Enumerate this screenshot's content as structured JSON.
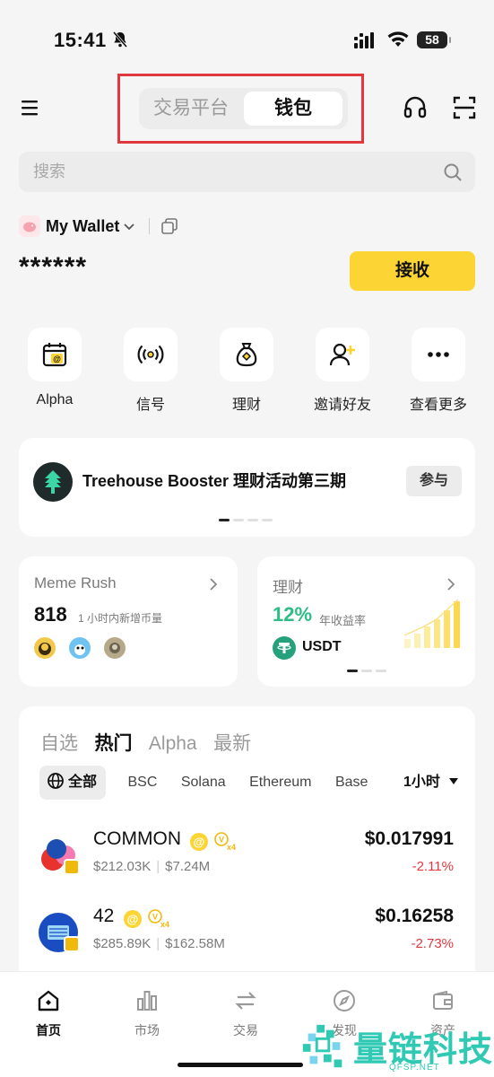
{
  "status_bar": {
    "time": "15:41",
    "battery": "58"
  },
  "header": {
    "tabs": [
      {
        "label": "交易平台",
        "active": false
      },
      {
        "label": "钱包",
        "active": true
      }
    ]
  },
  "search": {
    "placeholder": "搜索"
  },
  "wallet": {
    "name": "My Wallet",
    "balance": "******",
    "receive_label": "接收"
  },
  "actions": [
    {
      "label": "Alpha",
      "icon": "calendar-alpha-icon"
    },
    {
      "label": "信号",
      "icon": "broadcast-icon"
    },
    {
      "label": "理财",
      "icon": "money-bag-icon"
    },
    {
      "label": "邀请好友",
      "icon": "invite-user-icon"
    },
    {
      "label": "查看更多",
      "icon": "more-icon"
    }
  ],
  "banner": {
    "title": "Treehouse Booster 理财活动第三期",
    "join_label": "参与"
  },
  "meme_card": {
    "title": "Meme Rush",
    "count": "818",
    "subtitle": "1 小时内新增币量"
  },
  "earn_card": {
    "title": "理财",
    "apy": "12%",
    "apy_label": "年收益率",
    "asset": "USDT"
  },
  "markets": {
    "tabs": [
      {
        "label": "自选",
        "active": false
      },
      {
        "label": "热门",
        "active": true
      },
      {
        "label": "Alpha",
        "active": false
      },
      {
        "label": "最新",
        "active": false
      }
    ],
    "chains": [
      "全部",
      "BSC",
      "Solana",
      "Ethereum",
      "Base"
    ],
    "time_filter": "1小时",
    "tokens": [
      {
        "symbol": "COMMON",
        "market_cap": "$212.03K",
        "volume": "$7.24M",
        "price": "$0.017991",
        "change": "-2.11%",
        "multiplier": "x4"
      },
      {
        "symbol": "42",
        "market_cap": "$285.89K",
        "volume": "$162.58M",
        "price": "$0.16258",
        "change": "-2.73%",
        "multiplier": "x4"
      }
    ]
  },
  "bottom_nav": [
    {
      "label": "首页",
      "active": true
    },
    {
      "label": "市场",
      "active": false
    },
    {
      "label": "交易",
      "active": false
    },
    {
      "label": "发现",
      "active": false
    },
    {
      "label": "资产",
      "active": false
    }
  ],
  "watermark": {
    "text": "量链科技",
    "sub": "QFSP.NET"
  },
  "colors": {
    "brand_yellow": "#fcd535",
    "positive": "#2ebd85",
    "negative": "#e0383e",
    "highlight_red": "#e0383e"
  }
}
